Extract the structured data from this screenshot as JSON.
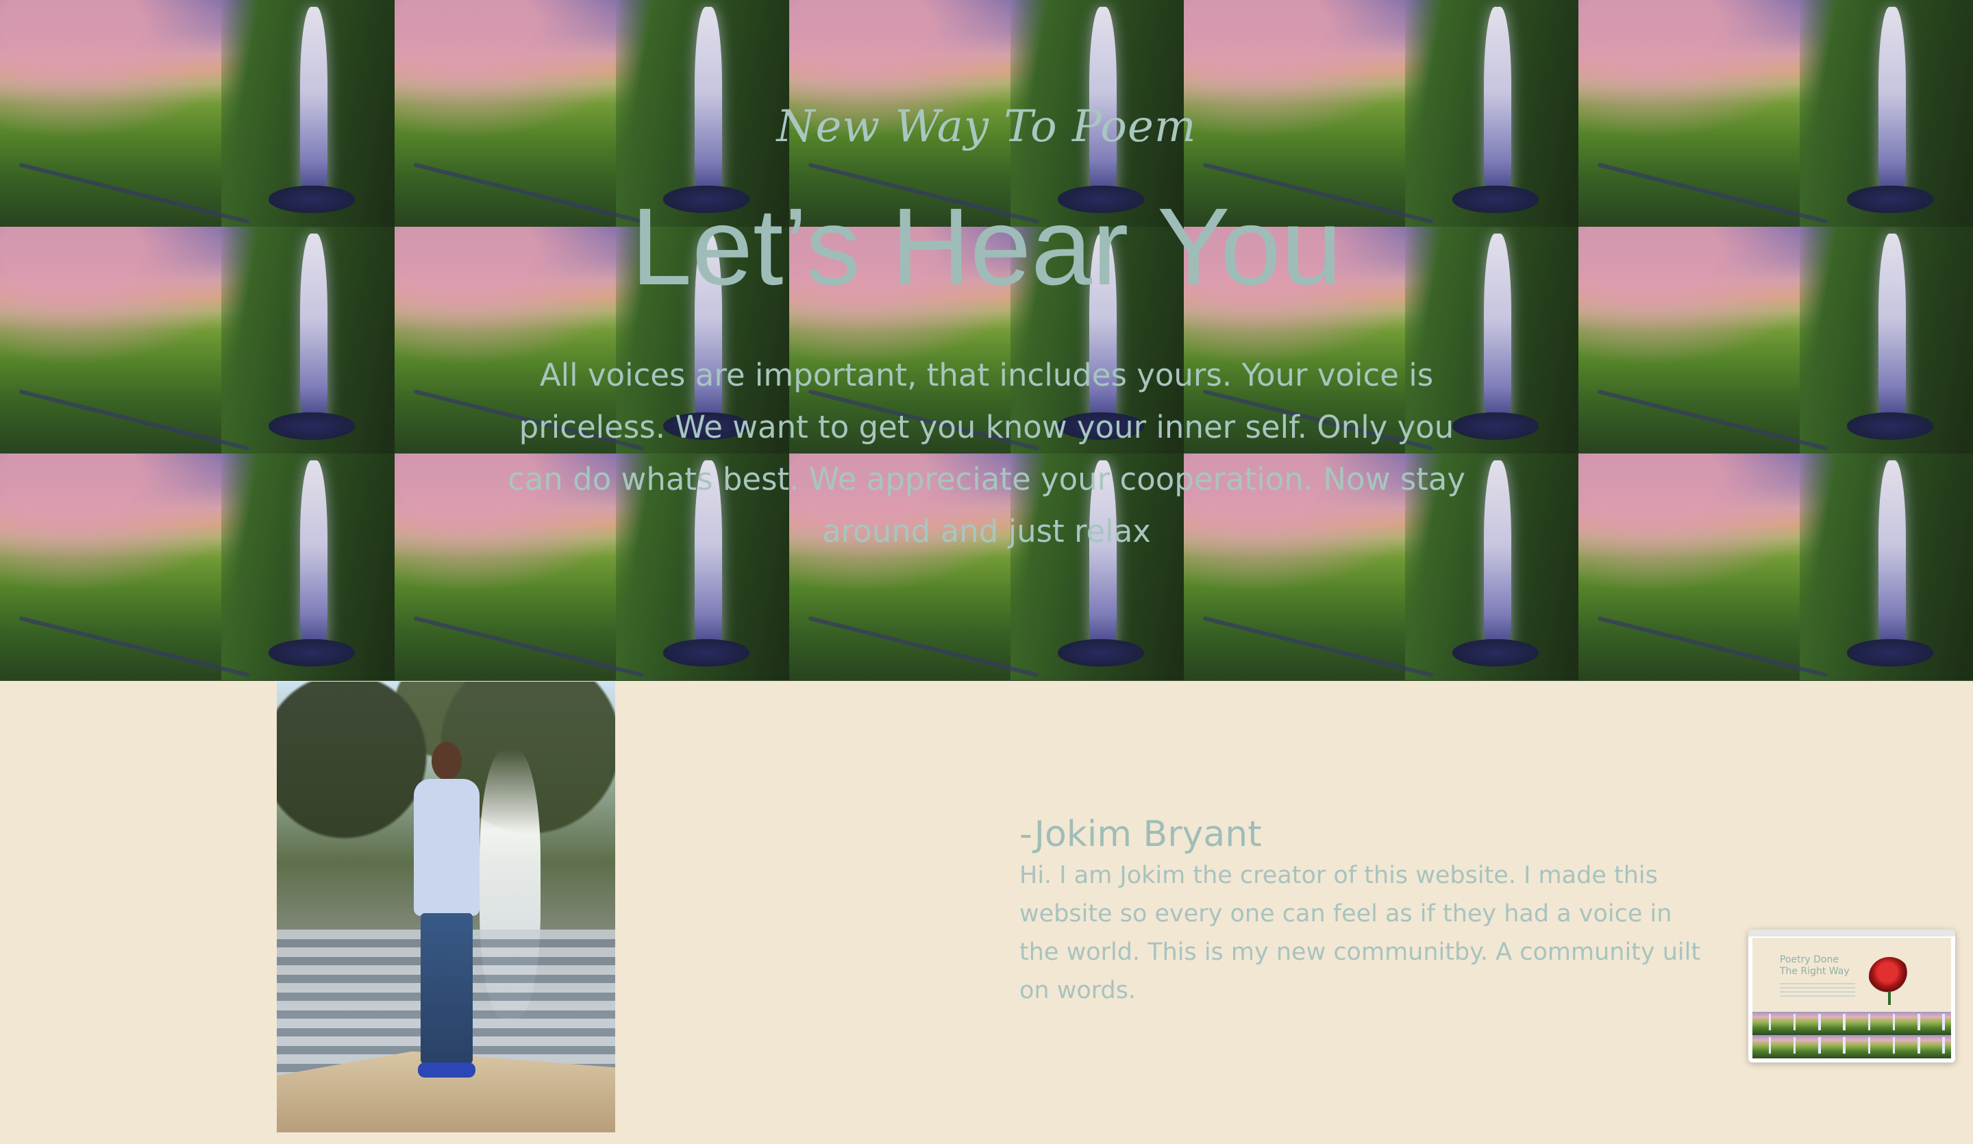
{
  "hero": {
    "kicker": "New Way To Poem",
    "headline": "Let’s Hear You",
    "lead": "All voices are important, that includes yours. Your voice is priceless. We want to get you know your inner self. Only you can do whats best. We appreciate your cooperation. Now stay around and just relax"
  },
  "about": {
    "name": "-Jokim Bryant",
    "bio": "Hi. I am Jokim the creator of this website. I made this website so every one can feel as if they had a voice in the world. This is my new communitby. A community uilt on words."
  },
  "preview": {
    "title_line1": "Poetry Done",
    "title_line2": "The Right Way"
  }
}
